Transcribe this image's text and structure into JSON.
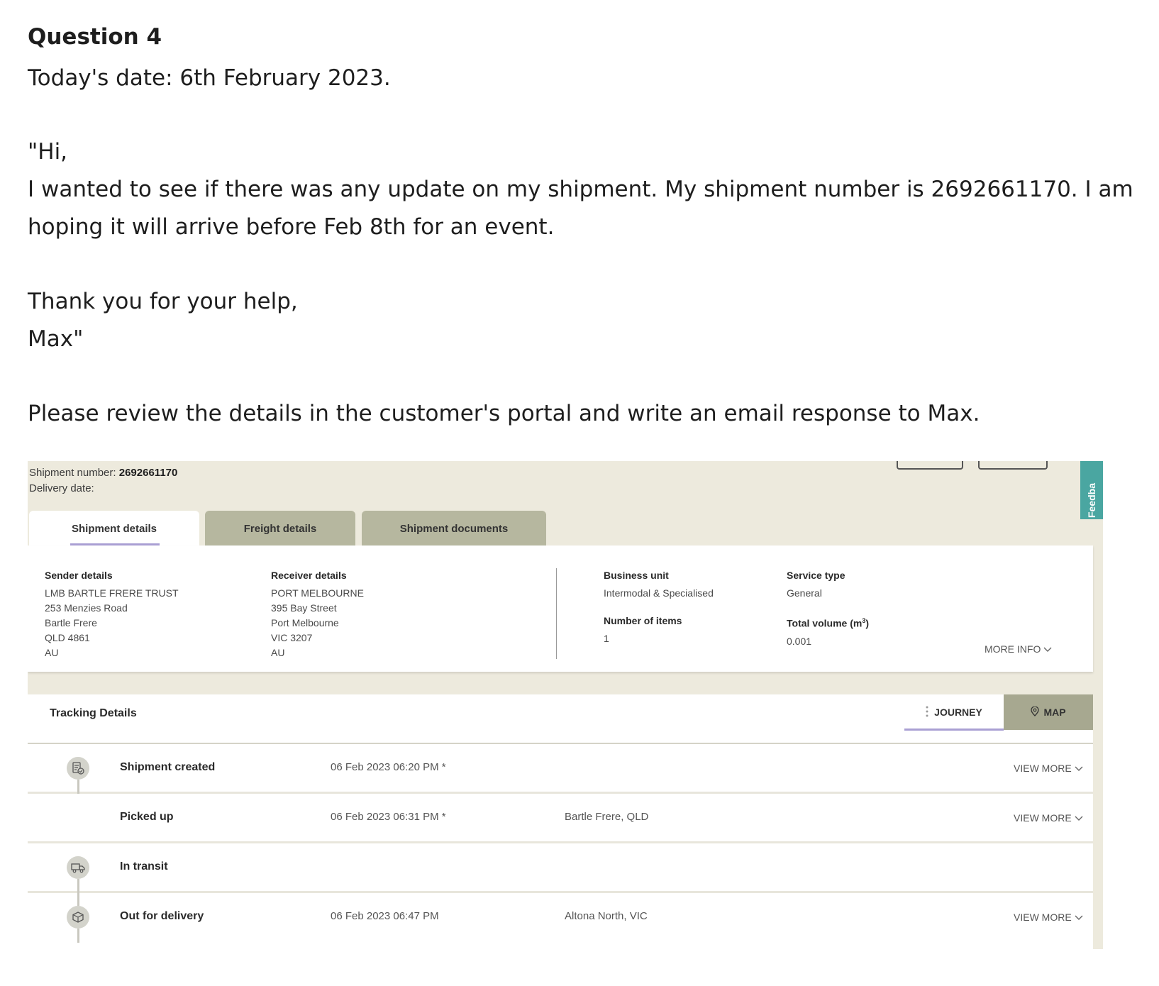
{
  "question": {
    "title": "Question 4",
    "date_line": "Today's date: 6th February 2023.",
    "greeting": "\"Hi,",
    "body_line1": "I wanted to see if there was any update on my shipment. My shipment number is 2692661170. I am",
    "body_line2": "hoping it will arrive before Feb 8th for an event.",
    "thanks": "Thank you for your help,",
    "signature": "Max\"",
    "instruction": "Please review the details in the customer's portal and write an email response to Max."
  },
  "portal": {
    "shipment_number_label": "Shipment number:",
    "shipment_number": "2692661170",
    "delivery_date_label": "Delivery date:",
    "feedback_label": "Feedba",
    "tabs": [
      {
        "label": "Shipment details"
      },
      {
        "label": "Freight details"
      },
      {
        "label": "Shipment documents"
      }
    ],
    "sender": {
      "label": "Sender details",
      "name": "LMB BARTLE FRERE TRUST",
      "street": "253 Menzies Road",
      "suburb": "Bartle Frere",
      "state_post": "QLD 4861",
      "country": "AU"
    },
    "receiver": {
      "label": "Receiver details",
      "name": "PORT MELBOURNE",
      "street": "395 Bay Street",
      "suburb": "Port Melbourne",
      "state_post": "VIC 3207",
      "country": "AU"
    },
    "business_unit": {
      "label": "Business unit",
      "value": "Intermodal & Specialised"
    },
    "service_type": {
      "label": "Service type",
      "value": "General"
    },
    "number_of_items": {
      "label": "Number of items",
      "value": "1"
    },
    "total_volume": {
      "label": "Total volume (m",
      "sup": "3",
      "label_end": ")",
      "value": "0.001"
    },
    "more_info": "MORE INFO",
    "tracking": {
      "title": "Tracking Details",
      "journey": "JOURNEY",
      "map": "MAP",
      "events": [
        {
          "status": "Shipment created",
          "time": "06 Feb 2023 06:20 PM *",
          "place": "",
          "view_more": "VIEW MORE"
        },
        {
          "status": "Picked up",
          "time": "06 Feb 2023 06:31 PM *",
          "place": "Bartle Frere, QLD",
          "view_more": "VIEW MORE"
        },
        {
          "status": "In transit",
          "time": "",
          "place": "",
          "view_more": ""
        },
        {
          "status": "Out for delivery",
          "time": "06 Feb 2023 06:47 PM",
          "place": "Altona North, VIC",
          "view_more": "VIEW MORE"
        }
      ]
    }
  }
}
